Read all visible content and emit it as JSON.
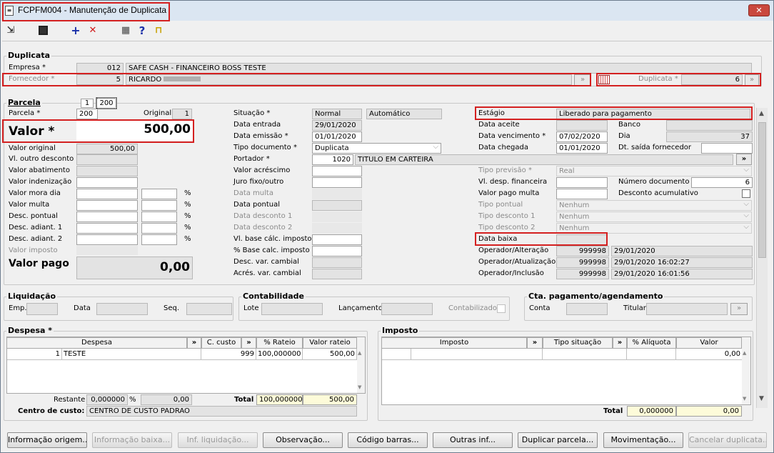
{
  "window": {
    "title": "FCPFM004 - Manutenção de Duplicata",
    "close": "✕"
  },
  "toolbar": {
    "exit": "⇲",
    "save": "💾",
    "add": "+",
    "delete": "✕",
    "calc": "▦",
    "help": "?",
    "door": "⊓"
  },
  "duplicata": {
    "section": "Duplicata",
    "empresa_label": "Empresa *",
    "empresa_code": "012",
    "empresa_name": "SAFE CASH - FINANCEIRO BOSS TESTE",
    "fornecedor_label": "Fornecedor *",
    "fornecedor_code": "5",
    "fornecedor_name": "RICARDO",
    "duplicata_label": "Duplicata *",
    "duplicata_value": "6",
    "lookup": "»"
  },
  "parcela": {
    "tab_label": "Parcela",
    "tab_num": "1",
    "tab_value": "200",
    "parcela_label": "Parcela *",
    "parcela_value": "200",
    "original_label": "Original",
    "original_value": "1",
    "valor_label": "Valor *",
    "valor_value": "500,00",
    "valor_original_label": "Valor original",
    "valor_original_value": "500,00",
    "vl_outro_desconto_label": "Vl. outro desconto",
    "valor_abatimento_label": "Valor abatimento",
    "valor_indenizacao_label": "Valor indenização",
    "valor_mora_dia_label": "Valor mora dia",
    "valor_multa_label": "Valor multa",
    "desc_pontual_label": "Desc. pontual",
    "desc_adiant1_label": "Desc. adiant. 1",
    "desc_adiant2_label": "Desc. adiant. 2",
    "valor_imposto_label": "Valor imposto",
    "valor_pago_label": "Valor pago",
    "valor_pago_value": "0,00",
    "pct": "%"
  },
  "middle": {
    "situacao_label": "Situação *",
    "situacao_value": "Normal",
    "situacao_tipo": "Automático",
    "data_entrada_label": "Data entrada",
    "data_entrada_value": "29/01/2020",
    "data_emissao_label": "Data emissão *",
    "data_emissao_value": "01/01/2020",
    "tipo_documento_label": "Tipo documento *",
    "tipo_documento_value": "Duplicata",
    "portador_label": "Portador *",
    "portador_code": "1020",
    "portador_name": "TITULO EM CARTEIRA",
    "valor_acrescimo_label": "Valor acréscimo",
    "juro_label": "Juro fixo/outro",
    "data_multa_label": "Data multa",
    "data_pontual_label": "Data pontual",
    "data_desconto1_label": "Data desconto 1",
    "data_desconto2_label": "Data desconto 2",
    "vl_base_label": "Vl. base cálc. imposto",
    "pct_base_label": "% Base calc. imposto",
    "desc_var_label": "Desc. var. cambial",
    "acres_var_label": "Acrés. var. cambial"
  },
  "right": {
    "estagio_label": "Estágio",
    "estagio_value": "Liberado para pagamento",
    "data_aceite_label": "Data aceite",
    "banco_label": "Banco",
    "data_vencimento_label": "Data vencimento *",
    "data_vencimento_value": "07/02/2020",
    "dia_label": "Dia",
    "dia_value": "37",
    "data_chegada_label": "Data chegada",
    "data_chegada_value": "01/01/2020",
    "dt_saida_label": "Dt. saída fornecedor",
    "tipo_previsao_label": "Tipo previsão *",
    "tipo_previsao_value": "Real",
    "vl_desp_fin_label": "Vl. desp. financeira",
    "numero_documento_label": "Número documento",
    "numero_documento_value": "6",
    "valor_pago_multa_label": "Valor pago multa",
    "desconto_acumulativo_label": "Desconto acumulativo",
    "tipo_pontual_label": "Tipo pontual",
    "tipo_pontual_value": "Nenhum",
    "tipo_desconto1_label": "Tipo desconto 1",
    "tipo_desconto1_value": "Nenhum",
    "tipo_desconto2_label": "Tipo desconto 2",
    "tipo_desconto2_value": "Nenhum",
    "data_baixa_label": "Data baixa",
    "op_alt_label": "Operador/Alteração",
    "op_alt_code": "999998",
    "op_alt_date": "29/01/2020",
    "op_atu_label": "Operador/Atualização",
    "op_atu_code": "999998",
    "op_atu_date": "29/01/2020 16:02:27",
    "op_inc_label": "Operador/Inclusão",
    "op_inc_code": "999998",
    "op_inc_date": "29/01/2020 16:01:56"
  },
  "liquidacao": {
    "title": "Liquidação",
    "emp_label": "Emp.",
    "data_label": "Data",
    "seq_label": "Seq."
  },
  "contabilidade": {
    "title": "Contabilidade",
    "lote_label": "Lote",
    "lancamento_label": "Lançamento",
    "contabilizado_label": "Contabilizado"
  },
  "cta": {
    "title": "Cta. pagamento/agendamento",
    "conta_label": "Conta",
    "titular_label": "Titular"
  },
  "despesa": {
    "title": "Despesa *",
    "headers": [
      "Despesa",
      "»",
      "C. custo",
      "»",
      "% Rateio",
      "Valor rateio"
    ],
    "row": {
      "num": "1",
      "name": "TESTE",
      "ccusto": "999",
      "rateio": "100,000000",
      "valor": "500,00"
    },
    "restante_label": "Restante",
    "restante_pct": "0,000000",
    "pct": "%",
    "restante_val": "0,00",
    "total_label": "Total",
    "total_pct": "100,000000",
    "total_val": "500,00",
    "centro_label": "Centro de custo:",
    "centro_value": "CENTRO DE CUSTO PADRAO"
  },
  "imposto": {
    "title": "Imposto",
    "headers": [
      "Imposto",
      "»",
      "Tipo situação",
      "»",
      "% Alíquota",
      "Valor"
    ],
    "row_valor": "0,00",
    "total_label": "Total",
    "total_pct": "0,000000",
    "total_val": "0,00"
  },
  "buttons": [
    {
      "label": "Informação origem...",
      "enabled": true
    },
    {
      "label": "Informação baixa...",
      "enabled": false
    },
    {
      "label": "Inf. liquidação...",
      "enabled": false
    },
    {
      "label": "Observação...",
      "enabled": true
    },
    {
      "label": "Código barras...",
      "enabled": true
    },
    {
      "label": "Outras inf...",
      "enabled": true
    },
    {
      "label": "Duplicar parcela...",
      "enabled": true
    },
    {
      "label": "Movimentação...",
      "enabled": true
    },
    {
      "label": "Cancelar duplicata...",
      "enabled": false
    }
  ]
}
